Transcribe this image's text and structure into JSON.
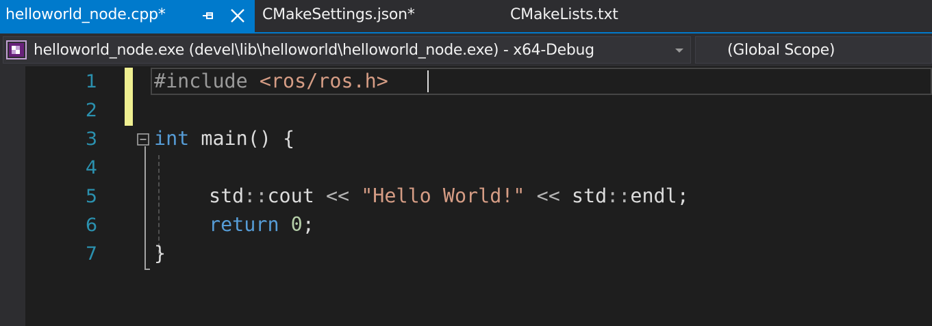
{
  "tabs": [
    {
      "label": "helloworld_node.cpp*",
      "active": true
    },
    {
      "label": "CMakeSettings.json*",
      "active": false
    },
    {
      "label": "CMakeLists.txt",
      "active": false
    }
  ],
  "navbar": {
    "project_combo": "helloworld_node.exe (devel\\lib\\helloworld\\helloworld_node.exe) - x64-Debug",
    "scope_combo": "(Global Scope)"
  },
  "editor": {
    "line_numbers": [
      "1",
      "2",
      "3",
      "4",
      "5",
      "6",
      "7"
    ],
    "code": {
      "l1": {
        "directive": "#include",
        "header": "<ros/ros.h>"
      },
      "l3": {
        "type": "int",
        "rest": "main() {"
      },
      "l5": {
        "ns1": "std",
        "sep1": "::",
        "id1": "cout",
        "op1": "<<",
        "string": "\"Hello World!\"",
        "op2": "<<",
        "ns2": "std",
        "sep2": "::",
        "id2": "endl;"
      },
      "l6": {
        "keyword": "return",
        "number": "0",
        "semi": ";"
      },
      "l7": {
        "brace": "}"
      }
    }
  },
  "colors": {
    "active_tab": "#007acc",
    "keyword": "#569cd6",
    "string": "#d69d85",
    "number": "#b5cea8",
    "line_number": "#2b91af",
    "change_marker": "#efef91"
  }
}
